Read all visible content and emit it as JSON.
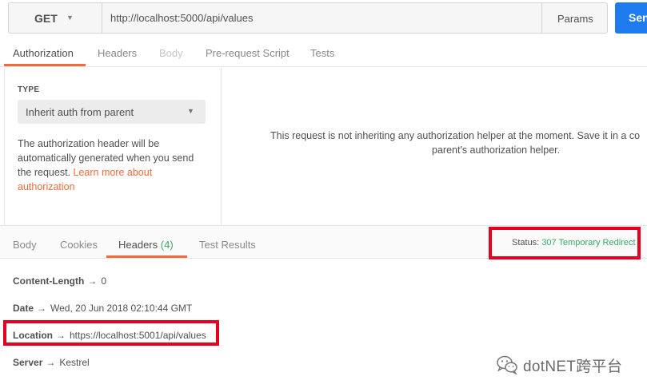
{
  "request": {
    "method": "GET",
    "url": "http://localhost:5000/api/values",
    "params_label": "Params",
    "send_label": "Send"
  },
  "request_tabs": [
    {
      "label": "Authorization",
      "state": "active"
    },
    {
      "label": "Headers",
      "state": "normal"
    },
    {
      "label": "Body",
      "state": "disabled"
    },
    {
      "label": "Pre-request Script",
      "state": "normal"
    },
    {
      "label": "Tests",
      "state": "normal"
    }
  ],
  "auth": {
    "type_label": "TYPE",
    "type_value": "Inherit auth from parent",
    "desc_part1": "The authorization header will be automatically generated when you send the request. ",
    "desc_link": "Learn more about authorization",
    "message_line1": "This request is not inheriting any authorization helper at the moment. Save it in a co",
    "message_line2": "parent's authorization helper."
  },
  "response_tabs": [
    {
      "label": "Body"
    },
    {
      "label": "Cookies"
    },
    {
      "label": "Headers",
      "count": "(4)"
    },
    {
      "label": "Test Results"
    }
  ],
  "status": {
    "label": "Status:",
    "value": "307 Temporary Redirect"
  },
  "headers": [
    {
      "key": "Content-Length",
      "arrow": "→",
      "value": "0"
    },
    {
      "key": "Date",
      "arrow": "→",
      "value": "Wed, 20 Jun 2018 02:10:44 GMT"
    },
    {
      "key": "Location",
      "arrow": "→",
      "value": "https://localhost:5001/api/values"
    },
    {
      "key": "Server",
      "arrow": "→",
      "value": "Kestrel"
    }
  ],
  "watermark": {
    "text": "dotNET跨平台"
  },
  "colors": {
    "accent": "#f26b3a",
    "send_button": "#1e7bf0",
    "status_ok": "#39a96b",
    "highlight_box": "#e6001f"
  },
  "icons": {
    "method_caret": "chevron-down-icon",
    "select_caret": "chevron-down-icon",
    "watermark_logo": "wechat-icon"
  }
}
